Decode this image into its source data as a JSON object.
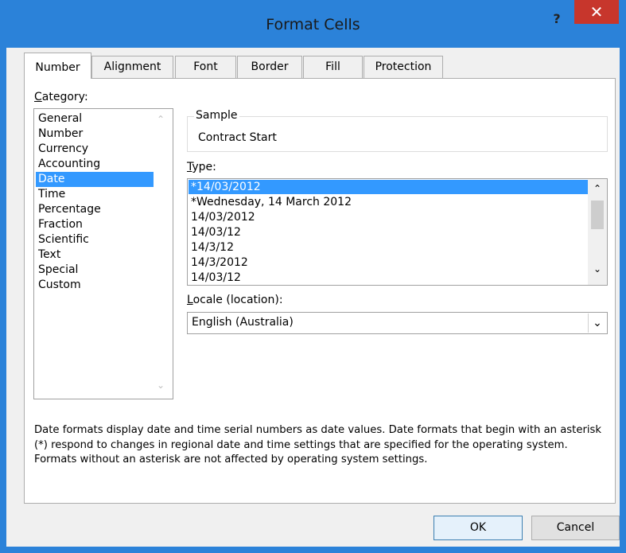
{
  "window": {
    "title": "Format Cells",
    "help_label": "?",
    "close_label": "✕"
  },
  "tabs": [
    {
      "label": "Number",
      "active": true
    },
    {
      "label": "Alignment",
      "active": false
    },
    {
      "label": "Font",
      "active": false
    },
    {
      "label": "Border",
      "active": false
    },
    {
      "label": "Fill",
      "active": false
    },
    {
      "label": "Protection",
      "active": false
    }
  ],
  "category": {
    "label_first": "C",
    "label_rest": "ategory:",
    "items": [
      "General",
      "Number",
      "Currency",
      "Accounting",
      "Date",
      "Time",
      "Percentage",
      "Fraction",
      "Scientific",
      "Text",
      "Special",
      "Custom"
    ],
    "selected": "Date"
  },
  "sample": {
    "label": "Sample",
    "value": "Contract Start"
  },
  "type": {
    "label_first": "T",
    "label_rest": "ype:",
    "items": [
      "*14/03/2012",
      "*Wednesday, 14 March 2012",
      "14/03/2012",
      "14/03/12",
      "14/3/12",
      "14/3/2012",
      "14/03/12"
    ],
    "selected": "*14/03/2012"
  },
  "locale": {
    "label_first": "L",
    "label_rest": "ocale (location):",
    "value": "English (Australia)"
  },
  "description": "Date formats display date and time serial numbers as date values.  Date formats that begin with an asterisk (*) respond to changes in regional date and time settings that are specified for the operating system. Formats without an asterisk are not affected by operating system settings.",
  "buttons": {
    "ok": "OK",
    "cancel": "Cancel"
  },
  "icons": {
    "up": "⌃",
    "down": "⌄",
    "dropdown": "⌄"
  },
  "colors": {
    "frame": "#2b82d9",
    "close": "#c7362c",
    "selection": "#3399ff"
  }
}
